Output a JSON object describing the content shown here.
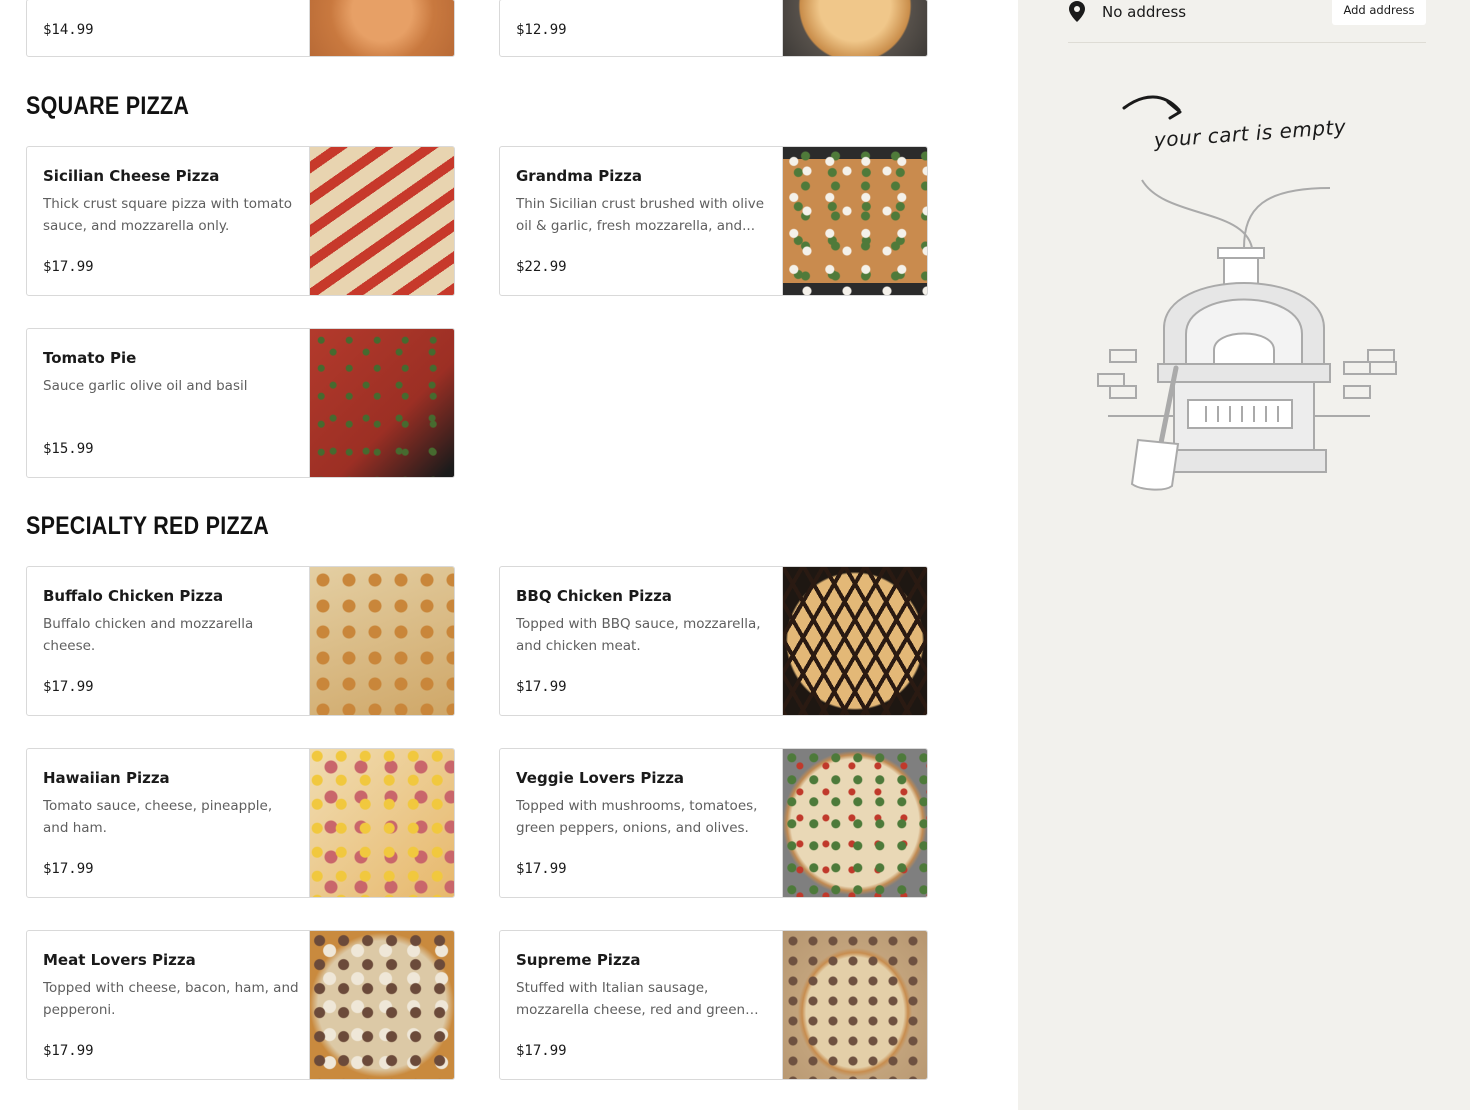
{
  "sections": [
    {
      "title": "SQUARE PIZZA"
    },
    {
      "title": "SPECIALTY RED PIZZA"
    }
  ],
  "items": [
    {
      "name": "",
      "desc": "",
      "price": "$14.99"
    },
    {
      "name": "",
      "desc": "",
      "price": "$12.99"
    },
    {
      "name": "Sicilian Cheese Pizza",
      "desc": "Thick crust square pizza with tomato sauce, and mozzarella only.",
      "price": "$17.99"
    },
    {
      "name": "Grandma Pizza",
      "desc": "Thin Sicilian crust brushed with olive oil & garlic, fresh mozzarella, and...",
      "price": "$22.99"
    },
    {
      "name": "Tomato Pie",
      "desc": "Sauce garlic olive oil and basil",
      "price": "$15.99"
    },
    {
      "name": "Buffalo Chicken Pizza",
      "desc": "Buffalo chicken and mozzarella cheese.",
      "price": "$17.99"
    },
    {
      "name": "BBQ Chicken Pizza",
      "desc": "Topped with BBQ sauce, mozzarella, and chicken meat.",
      "price": "$17.99"
    },
    {
      "name": "Hawaiian Pizza",
      "desc": "Tomato sauce, cheese, pineapple, and ham.",
      "price": "$17.99"
    },
    {
      "name": "Veggie Lovers Pizza",
      "desc": "Topped with mushrooms, tomatoes, green peppers, onions, and olives.",
      "price": "$17.99"
    },
    {
      "name": "Meat Lovers Pizza",
      "desc": "Topped with cheese, bacon, ham, and pepperoni.",
      "price": "$17.99"
    },
    {
      "name": "Supreme Pizza",
      "desc": "Stuffed with Italian sausage, mozzarella cheese, red and green peppers, onion...",
      "price": "$17.99"
    }
  ],
  "cart": {
    "address_text": "No address",
    "add_address_label": "Add address",
    "empty_text": "your cart is empty",
    "background": "#f2f1ed"
  },
  "icons": {
    "location": "map-pin-icon",
    "cart_empty": "pizza-oven-illustration"
  }
}
